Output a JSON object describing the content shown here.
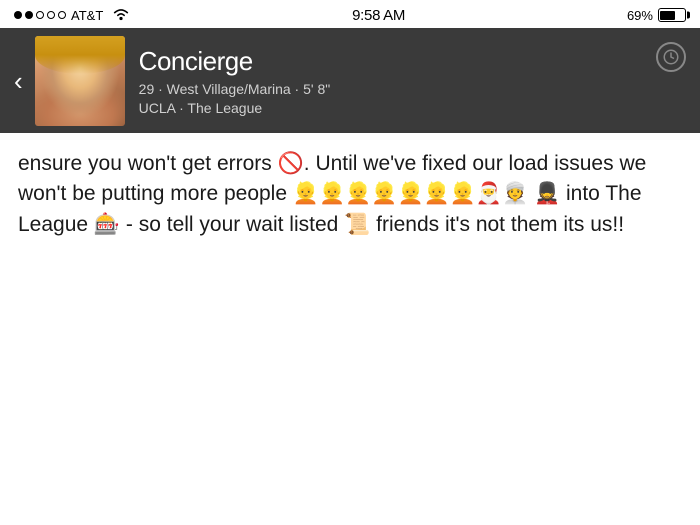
{
  "statusBar": {
    "carrier": "AT&T",
    "time": "9:58 AM",
    "battery": "69%"
  },
  "profile": {
    "name": "Concierge",
    "age": "29",
    "location": "West Village/Marina",
    "height": "5' 8\"",
    "school": "UCLA",
    "league": "The League",
    "details_line1": "29 · West Village/Marina · 5' 8\"",
    "details_line2": "UCLA · The League"
  },
  "message": {
    "text_part1": "ensure you won't get errors 🚫. Until we've fixed our load issues we won't be putting more people 👱👱👱👱👱👱👱🎅👳 💂 into The League 🎰 - so tell your wait listed 📜 friends it's not them its us!!"
  },
  "icons": {
    "back": "‹",
    "clock": "clock-icon"
  }
}
